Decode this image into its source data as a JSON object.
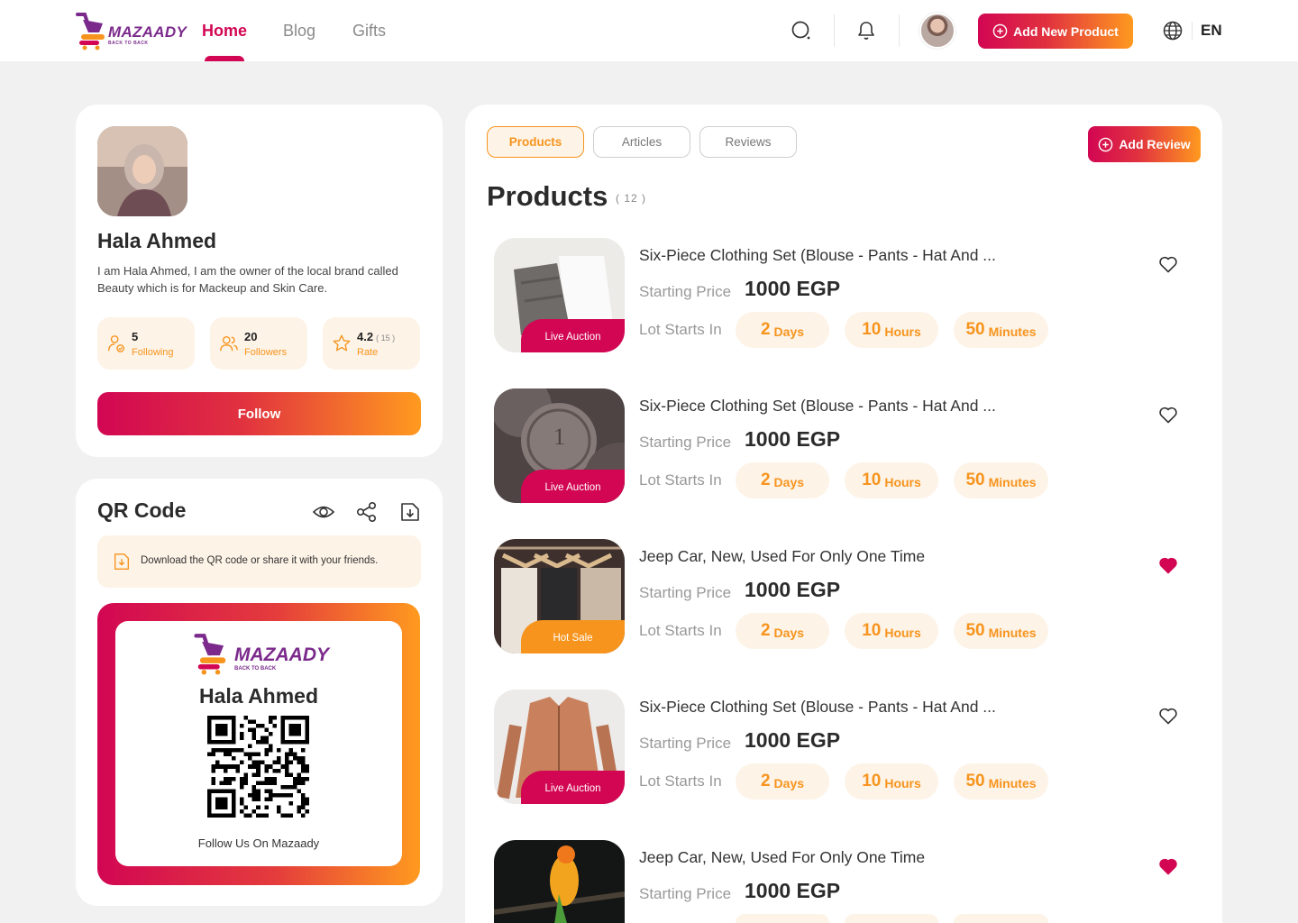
{
  "header": {
    "logo_text": "MAZAADY",
    "logo_tagline": "BACK TO BACK",
    "nav": [
      {
        "label": "Home",
        "active": true
      },
      {
        "label": "Blog",
        "active": false
      },
      {
        "label": "Gifts",
        "active": false
      }
    ],
    "icons": [
      "search-icon",
      "bell-icon",
      "globe-icon"
    ],
    "add_product_label": "Add New Product",
    "language": "EN"
  },
  "profile": {
    "name": "Hala Ahmed",
    "bio": "I am Hala Ahmed, I am the owner of the local brand called Beauty which is for Mackeup and Skin Care.",
    "stats": [
      {
        "value": "5",
        "label": "Following",
        "icon": "user-check-icon"
      },
      {
        "value": "20",
        "label": "Followers",
        "icon": "users-icon"
      },
      {
        "value": "4.2",
        "count": "( 15 )",
        "label": "Rate",
        "icon": "star-badge-icon"
      }
    ],
    "follow_label": "Follow"
  },
  "qr": {
    "title": "QR Code",
    "actions": [
      "eye-icon",
      "share-icon",
      "download-icon"
    ],
    "note": "Download the QR code or share it with your friends.",
    "logo_text": "MAZAADY",
    "logo_tagline": "BACK TO BACK",
    "name": "Hala Ahmed",
    "footer": "Follow Us On Mazaady"
  },
  "main": {
    "tabs": [
      {
        "label": "Products",
        "active": true
      },
      {
        "label": "Articles",
        "active": false
      },
      {
        "label": "Reviews",
        "active": false
      }
    ],
    "add_review_label": "Add Review",
    "title": "Products",
    "count": "( 12 )",
    "price_label": "Starting Price",
    "lot_label": "Lot Starts In",
    "colors": {
      "primary": "#d20653",
      "accent": "#f7941d",
      "pill_bg": "#fdf3e7"
    },
    "items": [
      {
        "title": "Six-Piece Clothing Set (Blouse - Pants - Hat And ...",
        "price": "1000 EGP",
        "badge": "Live Auction",
        "badge_type": "live",
        "liked": false,
        "countdown": [
          {
            "v": "2",
            "u": "Days"
          },
          {
            "v": "10",
            "u": "Hours"
          },
          {
            "v": "50",
            "u": "Minutes"
          }
        ]
      },
      {
        "title": "Six-Piece Clothing Set (Blouse - Pants - Hat And ...",
        "price": "1000 EGP",
        "badge": "Live Auction",
        "badge_type": "live",
        "liked": false,
        "countdown": [
          {
            "v": "2",
            "u": "Days"
          },
          {
            "v": "10",
            "u": "Hours"
          },
          {
            "v": "50",
            "u": "Minutes"
          }
        ]
      },
      {
        "title": "Jeep Car, New, Used For Only One Time",
        "price": "1000 EGP",
        "badge": "Hot Sale",
        "badge_type": "hot",
        "liked": true,
        "countdown": [
          {
            "v": "2",
            "u": "Days"
          },
          {
            "v": "10",
            "u": "Hours"
          },
          {
            "v": "50",
            "u": "Minutes"
          }
        ]
      },
      {
        "title": "Six-Piece Clothing Set (Blouse - Pants - Hat And ...",
        "price": "1000 EGP",
        "badge": "Live Auction",
        "badge_type": "live",
        "liked": false,
        "countdown": [
          {
            "v": "2",
            "u": "Days"
          },
          {
            "v": "10",
            "u": "Hours"
          },
          {
            "v": "50",
            "u": "Minutes"
          }
        ]
      },
      {
        "title": "Jeep Car, New, Used For Only One Time",
        "price": "1000 EGP",
        "badge": "",
        "badge_type": "hot",
        "liked": true,
        "countdown": []
      }
    ]
  }
}
